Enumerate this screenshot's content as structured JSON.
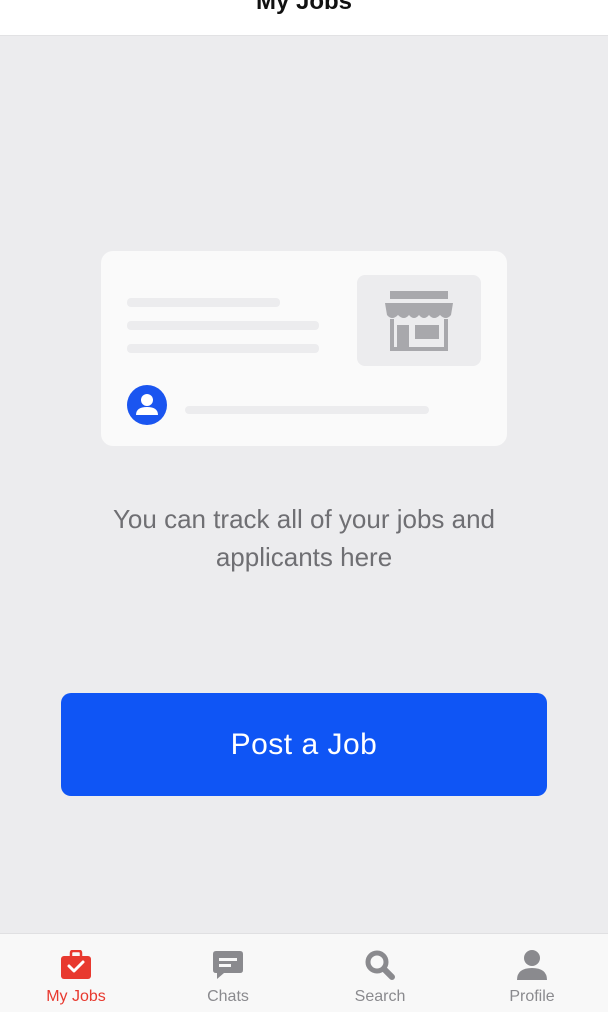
{
  "header": {
    "title": "My Jobs"
  },
  "illustration": {
    "store_icon": "storefront-icon",
    "avatar_icon": "person-icon"
  },
  "empty_state": {
    "message": "You can track all of your jobs and applicants here"
  },
  "actions": {
    "post_job_label": "Post a Job"
  },
  "tabbar": {
    "items": [
      {
        "label": "My Jobs",
        "icon": "briefcase-check-icon",
        "active": true
      },
      {
        "label": "Chats",
        "icon": "chat-bubble-icon",
        "active": false
      },
      {
        "label": "Search",
        "icon": "magnifier-icon",
        "active": false
      },
      {
        "label": "Profile",
        "icon": "person-icon",
        "active": false
      }
    ]
  },
  "colors": {
    "accent": "#0f55f5",
    "active_tab": "#e8392f",
    "inactive_tab": "#8a8a8e",
    "background": "#ececee"
  }
}
